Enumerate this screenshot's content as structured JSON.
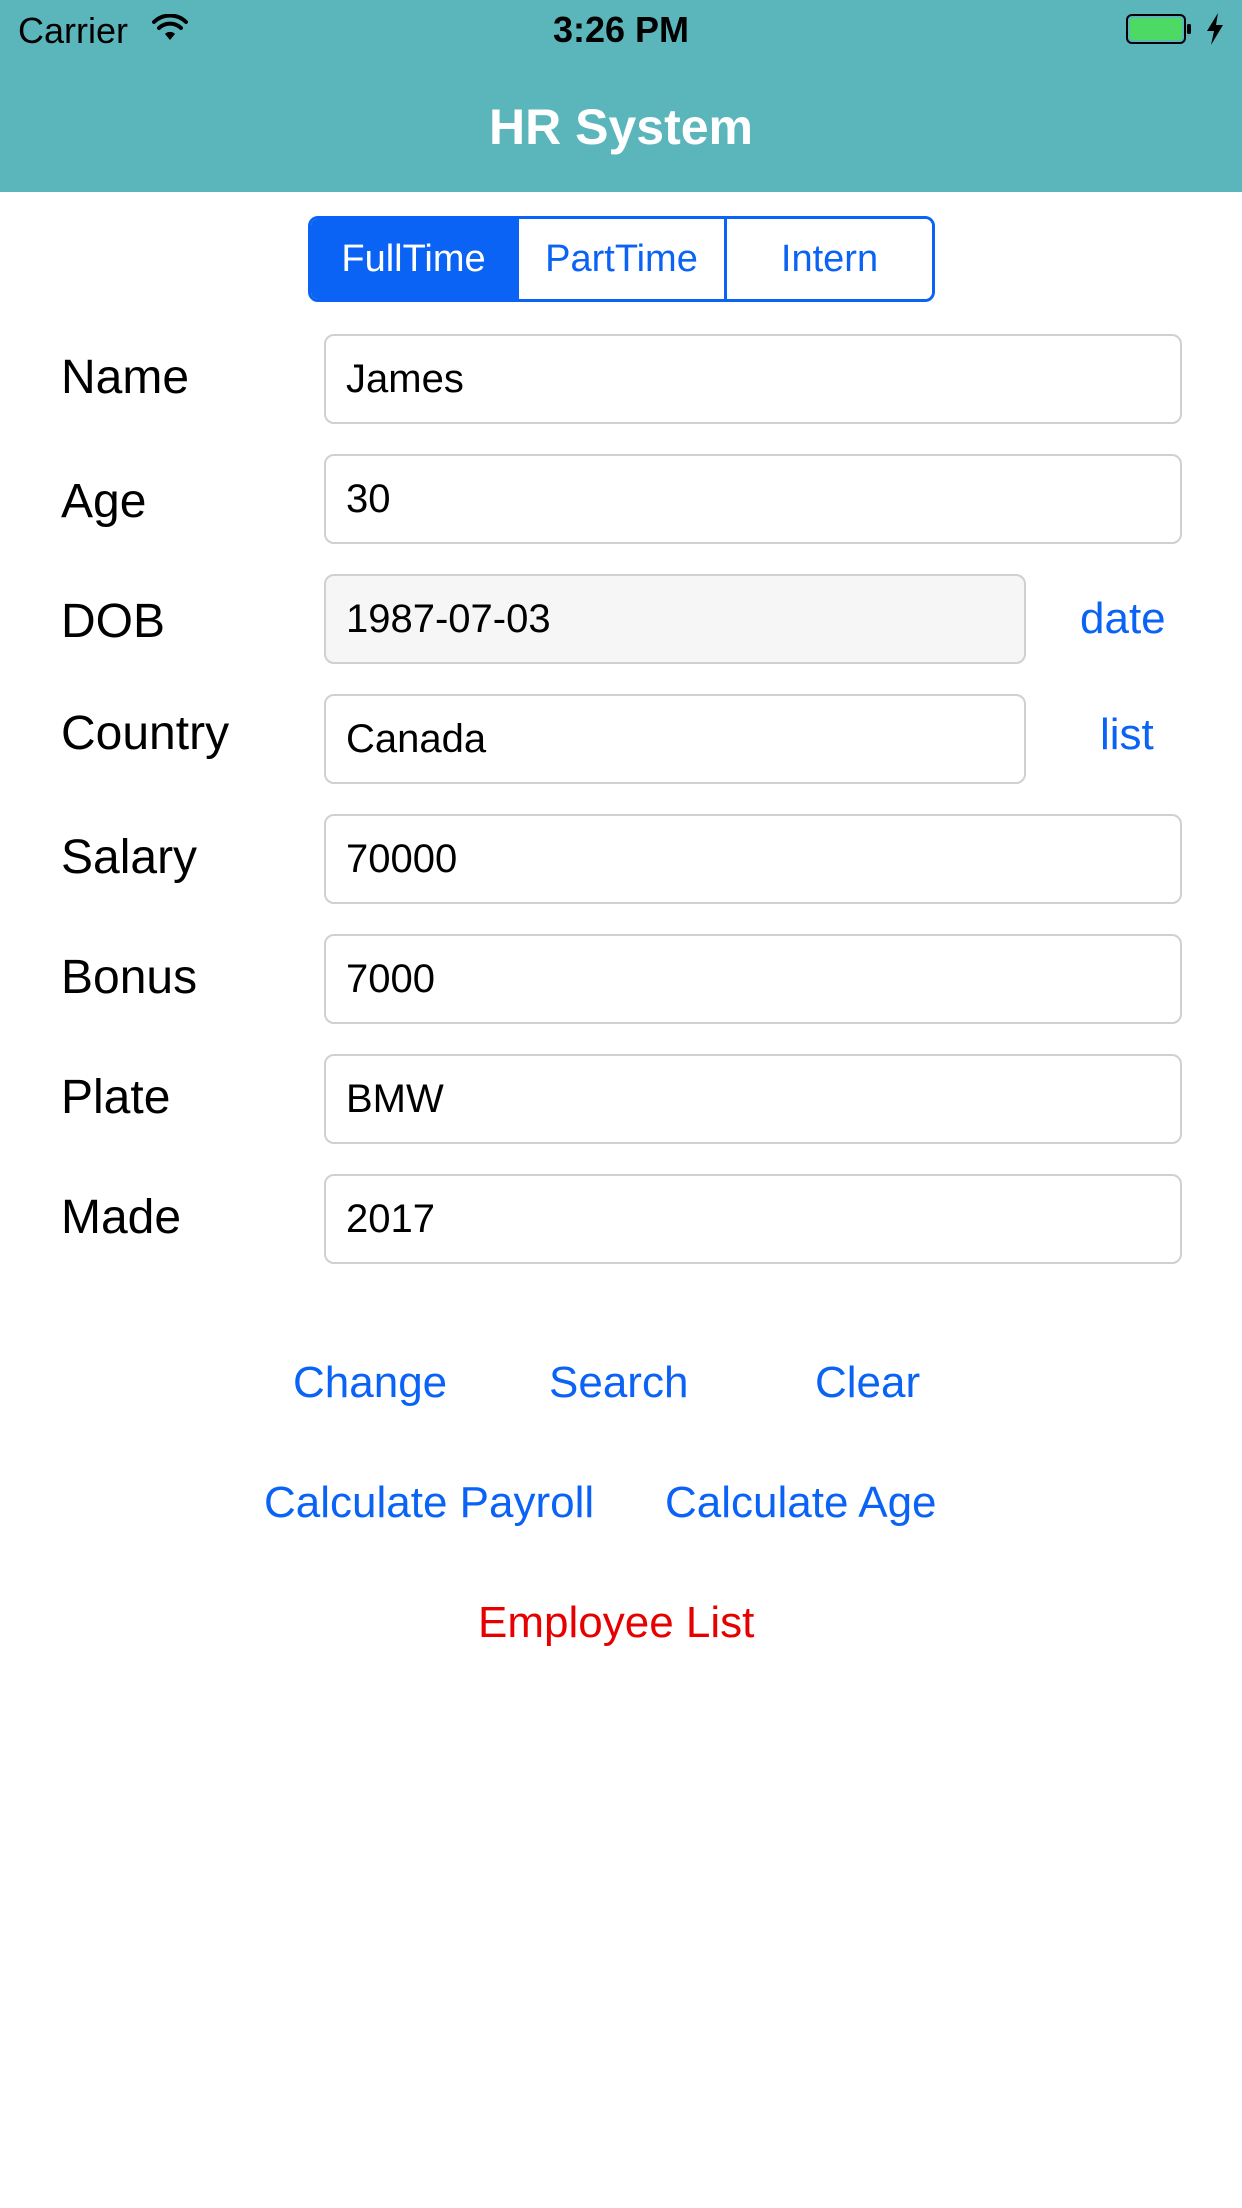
{
  "status_bar": {
    "carrier": "Carrier",
    "time": "3:26 PM",
    "wifi_icon": "wifi-icon",
    "battery_icon": "battery-icon",
    "charging_icon": "bolt-icon",
    "battery_color": "#4cd964"
  },
  "nav": {
    "title": "HR System",
    "background": "#5bb6bc"
  },
  "segments": {
    "items": [
      "FullTime",
      "PartTime",
      "Intern"
    ],
    "selected": "FullTime",
    "accent": "#0b63f6"
  },
  "form": {
    "name": {
      "label": "Name",
      "value": "James"
    },
    "age": {
      "label": "Age",
      "value": "30"
    },
    "dob": {
      "label": "DOB",
      "value": "1987-07-03",
      "action": "date"
    },
    "country": {
      "label": "Country",
      "value": "Canada",
      "action": "list"
    },
    "salary": {
      "label": "Salary",
      "value": "70000"
    },
    "bonus": {
      "label": "Bonus",
      "value": "7000"
    },
    "plate": {
      "label": "Plate",
      "value": "BMW"
    },
    "made": {
      "label": "Made",
      "value": "2017"
    }
  },
  "buttons": {
    "change": "Change",
    "search": "Search",
    "clear": "Clear",
    "calculate_payroll": "Calculate Payroll",
    "calculate_age": "Calculate Age",
    "employee_list": "Employee List",
    "employee_list_color": "#e60000"
  }
}
